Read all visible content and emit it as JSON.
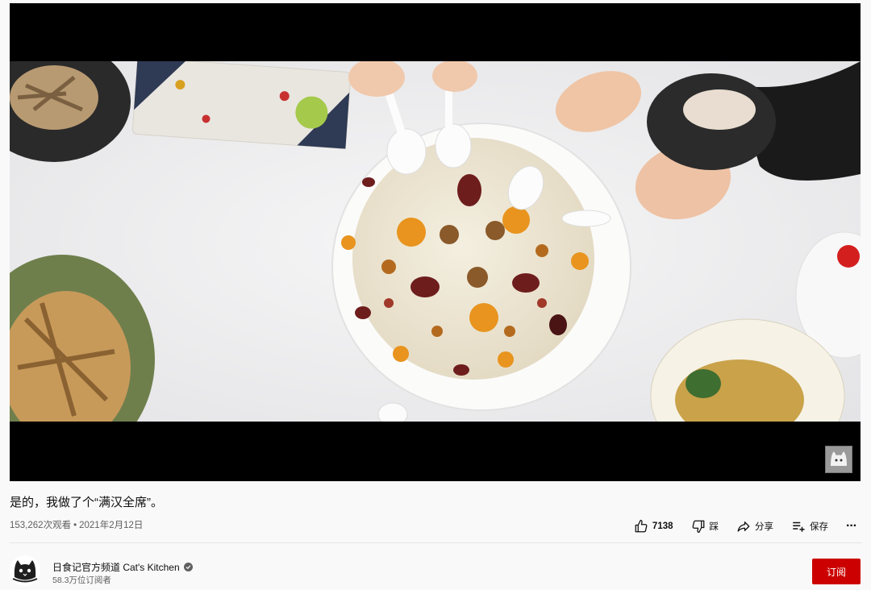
{
  "video": {
    "title": "是的，我做了个“满汉全席”。",
    "views": "153,262次观看",
    "separator": "•",
    "date": "2021年2月12日"
  },
  "actions": {
    "like_count": "7138",
    "dislike_label": "踩",
    "share_label": "分享",
    "save_label": "保存",
    "more_label": "···"
  },
  "channel": {
    "name": "日食记官方频道 Cat's Kitchen",
    "subscribers": "58.3万位订阅者",
    "subscribe_label": "订阅"
  },
  "icons": {
    "like": "thumbs-up-icon",
    "dislike": "thumbs-down-icon",
    "share": "share-arrow-icon",
    "save": "add-to-playlist-icon",
    "verified": "verified-check-icon"
  },
  "colors": {
    "subscribe_bg": "#cc0000",
    "secondary_text": "#606060",
    "page_bg": "#f9f9f9"
  }
}
